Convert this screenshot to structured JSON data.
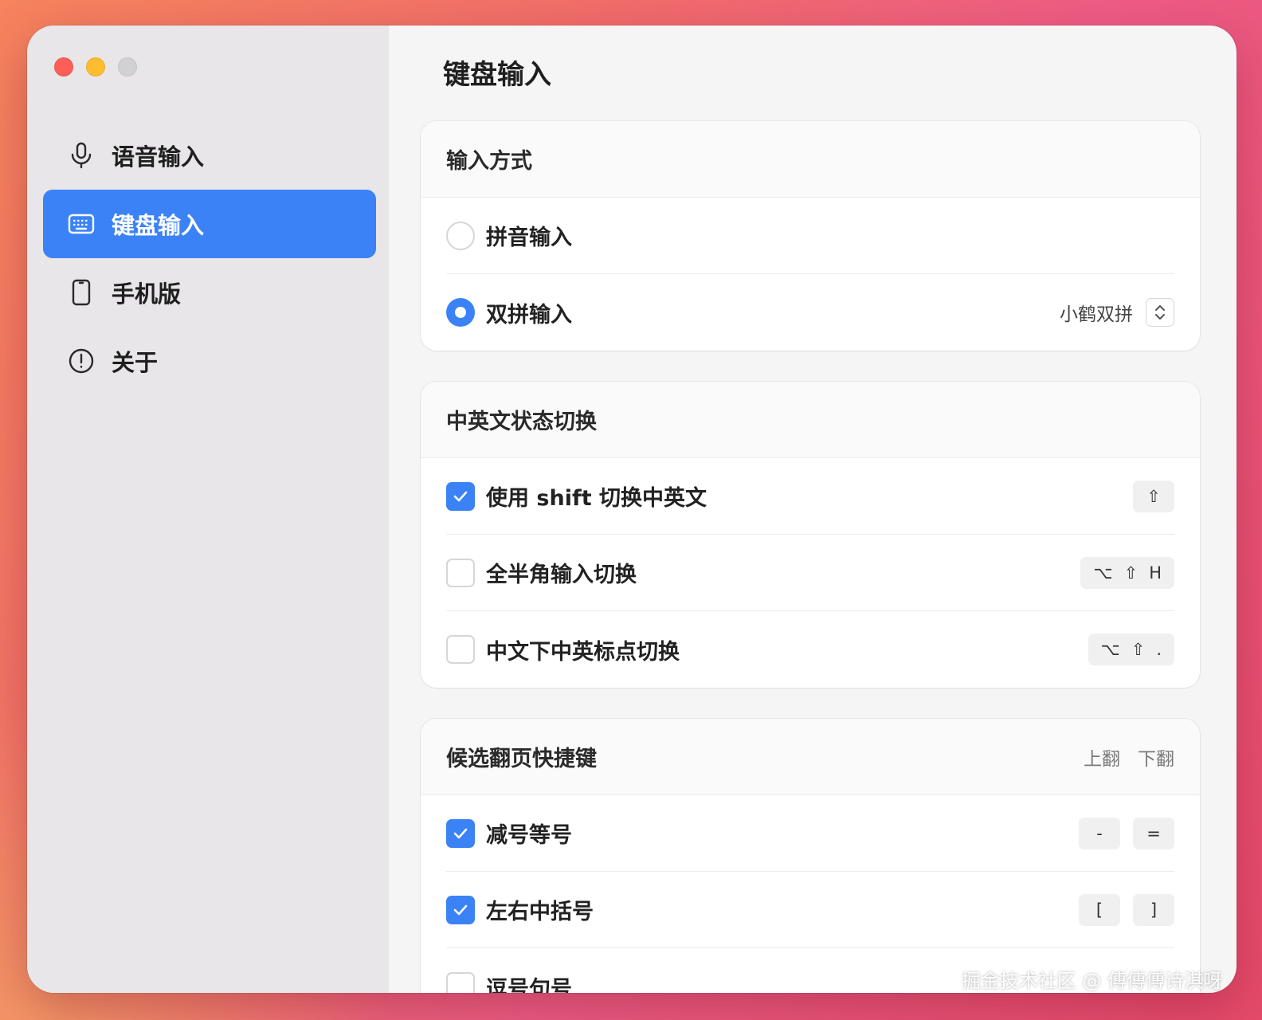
{
  "window": {
    "title": "键盘输入"
  },
  "sidebar": {
    "items": [
      {
        "label": "语音输入",
        "icon": "microphone-icon",
        "active": false
      },
      {
        "label": "键盘输入",
        "icon": "keyboard-icon",
        "active": true
      },
      {
        "label": "手机版",
        "icon": "phone-icon",
        "active": false
      },
      {
        "label": "关于",
        "icon": "info-icon",
        "active": false
      }
    ]
  },
  "sections": {
    "input_method": {
      "title": "输入方式",
      "pinyin_label": "拼音输入",
      "pinyin_selected": false,
      "shuangpin_label": "双拼输入",
      "shuangpin_selected": true,
      "shuangpin_scheme": "小鹤双拼"
    },
    "cn_en_switch": {
      "title": "中英文状态切换",
      "shift": {
        "label": "使用 shift 切换中英文",
        "checked": true,
        "keys": [
          "⇧"
        ]
      },
      "fullhalf": {
        "label": "全半角输入切换",
        "checked": false,
        "keys": [
          "⌥",
          "⇧",
          "H"
        ]
      },
      "punct": {
        "label": "中文下中英标点切换",
        "checked": false,
        "keys": [
          "⌥",
          "⇧",
          "."
        ]
      }
    },
    "paging": {
      "title": "候选翻页快捷键",
      "col_up": "上翻",
      "col_down": "下翻",
      "minus_equal": {
        "label": "减号等号",
        "checked": true,
        "up": "-",
        "down": "="
      },
      "brackets": {
        "label": "左右中括号",
        "checked": true,
        "up": "[",
        "down": "]"
      },
      "comma_period": {
        "label": "逗号句号",
        "checked": false
      }
    }
  },
  "watermark": "掘金技术社区 @ 傅傅傅诗淇呀",
  "colors": {
    "accent": "#3b82f6",
    "sidebar_bg": "#e8e6e8",
    "main_bg": "#f5f5f5"
  }
}
